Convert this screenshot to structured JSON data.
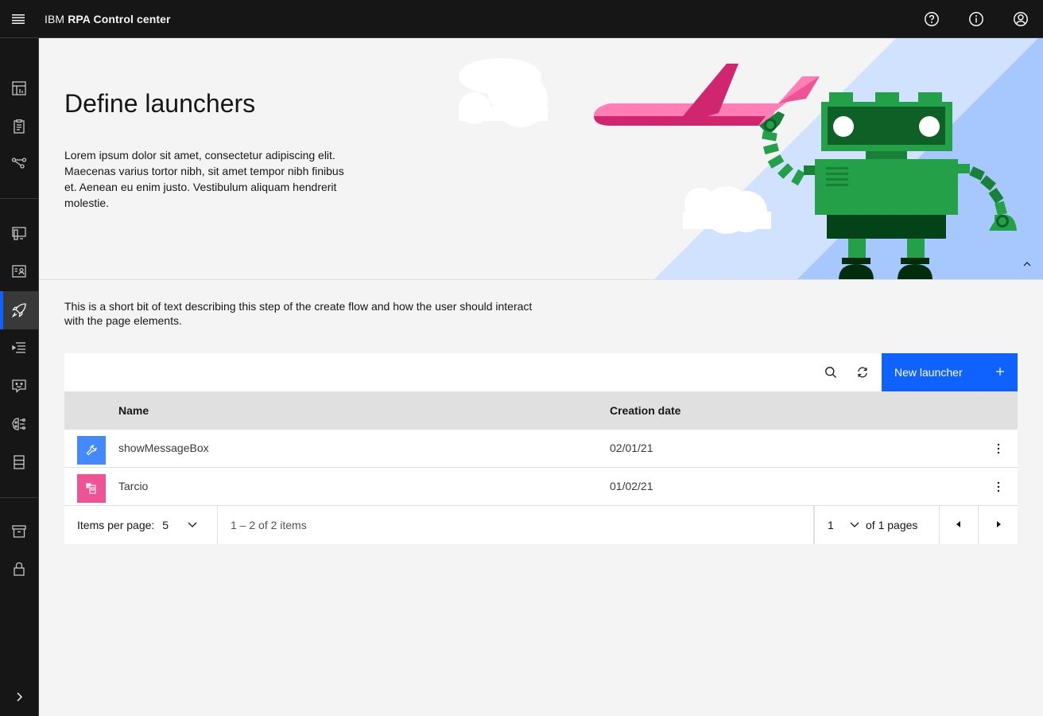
{
  "header": {
    "brand_prefix": "IBM",
    "brand_name": "RPA Control center",
    "icons": [
      "menu-icon",
      "help-icon",
      "information-icon",
      "user-avatar-icon"
    ]
  },
  "sidenav": {
    "items": [
      {
        "icon": "dashboard-icon"
      },
      {
        "icon": "clipboard-icon"
      },
      {
        "icon": "flow-icon"
      },
      {
        "icon": "computer-icon"
      },
      {
        "icon": "id-card-icon"
      },
      {
        "icon": "rocket-icon",
        "active": true
      },
      {
        "icon": "task-list-icon"
      },
      {
        "icon": "chatbot-icon"
      },
      {
        "icon": "machine-learning-icon"
      },
      {
        "icon": "data-table-icon"
      },
      {
        "icon": "archive-icon"
      },
      {
        "icon": "lock-icon"
      },
      {
        "icon": "chevron-right-icon"
      }
    ]
  },
  "banner": {
    "title": "Define launchers",
    "description": "Lorem ipsum dolor sit amet, consectetur adipiscing elit. Maecenas varius tortor nibh, sit amet tempor nibh finibus et. Aenean eu enim justo. Vestibulum aliquam hendrerit molestie."
  },
  "main": {
    "description": "This is a short bit of text describing this step of the create flow and how the user should interact with the page elements."
  },
  "table": {
    "new_button_label": "New launcher",
    "columns": [
      "Name",
      "Creation date"
    ],
    "rows": [
      {
        "name": "showMessageBox",
        "date": "02/01/21",
        "icon": "wrench-icon",
        "icon_color": "#4589ff"
      },
      {
        "name": "Tarcio",
        "date": "01/02/21",
        "icon": "mobile-qr-icon",
        "icon_color": "#ee5396"
      }
    ]
  },
  "pagination": {
    "items_per_page_label": "Items per page:",
    "items_per_page": "5",
    "range_text": "1 – 2 of 2 items",
    "page": "1",
    "of_pages": "of 1 pages"
  },
  "colors": {
    "accent": "#0f62fe",
    "header_bg": "#161616",
    "robot_green": "#24a148",
    "plane_pink": "#ee5396"
  }
}
